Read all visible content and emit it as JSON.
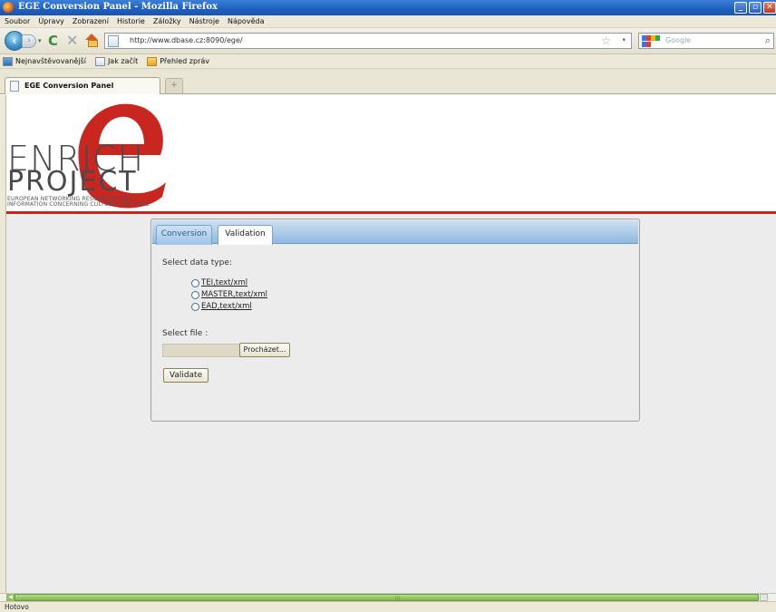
{
  "window": {
    "title": "EGE Conversion Panel - Mozilla Firefox",
    "buttons": [
      "_",
      "▫",
      "✕"
    ]
  },
  "menu": [
    "Soubor",
    "Úpravy",
    "Zobrazení",
    "Historie",
    "Záložky",
    "Nástroje",
    "Nápověda"
  ],
  "nav": {
    "url": "http://www.dbase.cz:8090/ege/",
    "search_placeholder": "Google"
  },
  "bookmarks": [
    "Nejnavštěvovanější",
    "Jak začít",
    "Přehled zpráv"
  ],
  "tabs": {
    "active_label": "EGE Conversion Panel",
    "new_tab": "+"
  },
  "logo": {
    "word1": "ENRICH",
    "word2": "PROJECT",
    "sub1": "EUROPEAN NETWORKING RESOURCES AND",
    "sub2": "INFORMATION CONCERNING CULTURAL HERITAGE",
    "accent_color": "#c8261f"
  },
  "panel": {
    "tabs": [
      "Conversion",
      "Validation"
    ],
    "active_tab": "Validation",
    "select_type_label": "Select data type:",
    "options": [
      "TEI,text/xml",
      "MASTER,text/xml",
      "EAD,text/xml"
    ],
    "select_file_label": "Select file :",
    "browse_label": "Procházet...",
    "validate_label": "Validate"
  },
  "status": "Hotovo"
}
